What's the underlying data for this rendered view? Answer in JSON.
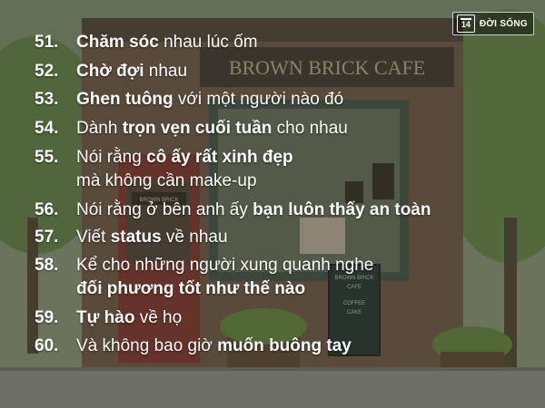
{
  "brand": {
    "badge": "14",
    "name": "ĐỜI SỐNG"
  },
  "items": [
    {
      "num": "51.",
      "lines": [
        [
          {
            "t": "Chăm sóc",
            "b": true
          },
          {
            "t": " nhau lúc ốm",
            "b": false
          }
        ]
      ]
    },
    {
      "num": "52.",
      "lines": [
        [
          {
            "t": "Chờ đợi",
            "b": true
          },
          {
            "t": " nhau",
            "b": false
          }
        ]
      ]
    },
    {
      "num": "53.",
      "lines": [
        [
          {
            "t": "Ghen tuông",
            "b": true
          },
          {
            "t": " với một người nào đó",
            "b": false
          }
        ]
      ]
    },
    {
      "num": "54.",
      "lines": [
        [
          {
            "t": "Dành ",
            "b": false
          },
          {
            "t": "trọn vẹn cuối tuần",
            "b": true
          },
          {
            "t": " cho nhau",
            "b": false
          }
        ]
      ]
    },
    {
      "num": "55.",
      "lines": [
        [
          {
            "t": "Nói rằng ",
            "b": false
          },
          {
            "t": "cô ấy rất xinh đẹp",
            "b": true
          }
        ],
        [
          {
            "t": "mà không cần make-up",
            "b": false
          }
        ]
      ]
    },
    {
      "num": "56.",
      "lines": [
        [
          {
            "t": "Nói rằng ở bên anh ấy ",
            "b": false
          },
          {
            "t": "bạn luôn thấy an toàn",
            "b": true
          }
        ]
      ]
    },
    {
      "num": "57.",
      "lines": [
        [
          {
            "t": "Viết ",
            "b": false
          },
          {
            "t": "status",
            "b": true
          },
          {
            "t": " về nhau",
            "b": false
          }
        ]
      ]
    },
    {
      "num": "58.",
      "lines": [
        [
          {
            "t": "Kể cho những người xung quanh nghe",
            "b": false
          }
        ],
        [
          {
            "t": "đối phương tốt như thế nào",
            "b": true
          }
        ]
      ]
    },
    {
      "num": "59.",
      "lines": [
        [
          {
            "t": "Tự hào",
            "b": true
          },
          {
            "t": " về họ",
            "b": false
          }
        ]
      ]
    },
    {
      "num": "60.",
      "lines": [
        [
          {
            "t": "Và không bao giờ ",
            "b": false
          },
          {
            "t": "muốn buông tay",
            "b": true
          }
        ]
      ]
    }
  ],
  "background": {
    "sign_text": "BROWN BRICK CAFE",
    "door_sign_text": "BROWN BRICK",
    "board_lines": [
      "BROWN BRICK",
      "CAFE",
      "COFFEE",
      "CAKE"
    ]
  }
}
